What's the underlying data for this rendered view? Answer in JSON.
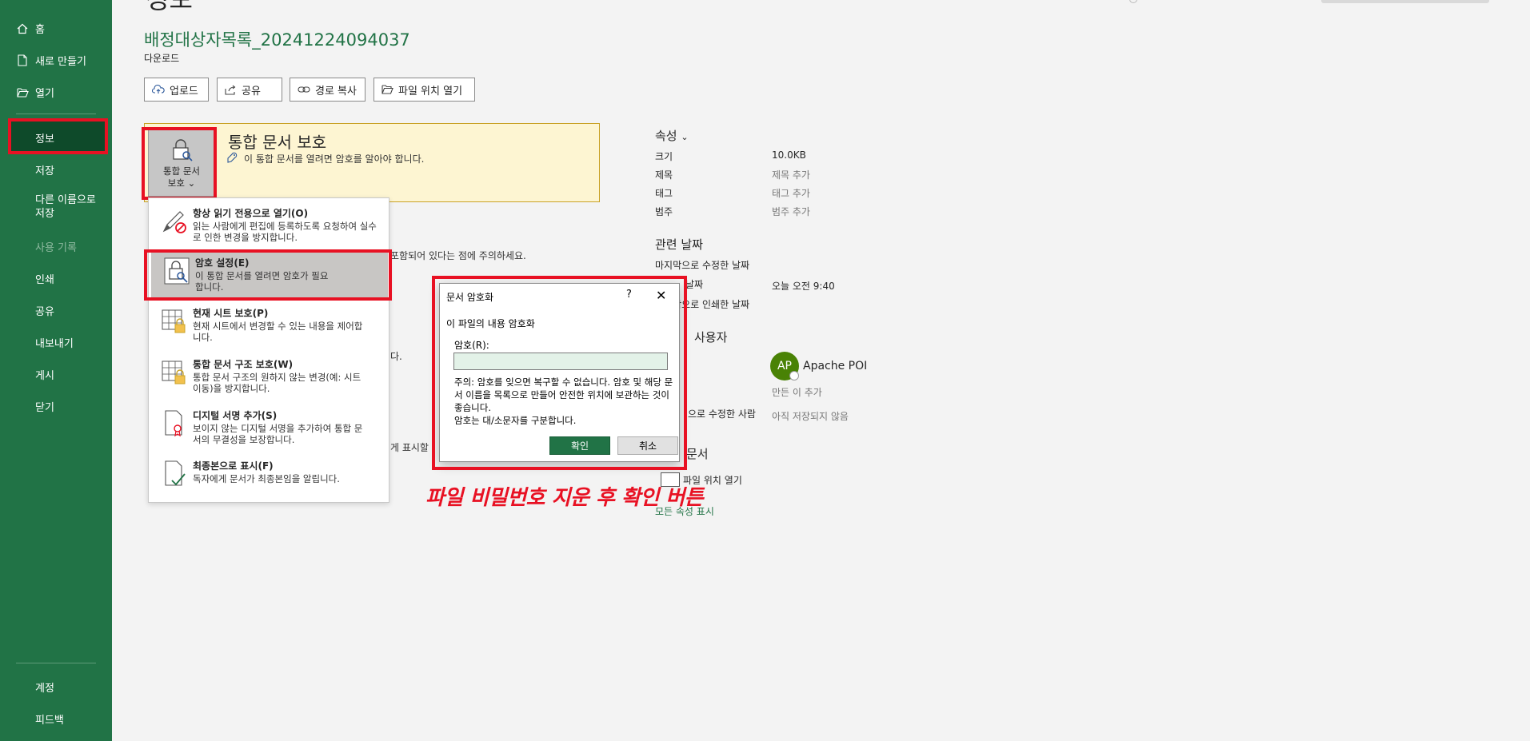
{
  "page": {
    "heading_partial": "정보",
    "title": "배정대상자목록_20241224094037",
    "location": "다운로드"
  },
  "sidebar": {
    "items": [
      {
        "label": "홈",
        "icon": "home-icon"
      },
      {
        "label": "새로 만들기",
        "icon": "new-file-icon"
      },
      {
        "label": "열기",
        "icon": "folder-open-icon"
      },
      {
        "label": "정보"
      },
      {
        "label": "저장"
      },
      {
        "label": "다른 이름으로 저장"
      },
      {
        "label": "사용 기록"
      },
      {
        "label": "인쇄"
      },
      {
        "label": "공유"
      },
      {
        "label": "내보내기"
      },
      {
        "label": "게시"
      },
      {
        "label": "닫기"
      },
      {
        "label": "계정"
      },
      {
        "label": "피드백"
      }
    ],
    "selected": "정보"
  },
  "toolbar": {
    "upload": "업로드",
    "share": "공유",
    "copy_path": "경로 복사",
    "open_location": "파일 위치 열기"
  },
  "protect": {
    "button_line1": "통합 문서",
    "button_line2": "보호",
    "title": "통합 문서 보호",
    "desc": "이 통합 문서를 열려면 암호를 알아야 합니다."
  },
  "menu": {
    "items": [
      {
        "title": "항상 읽기 전용으로 열기(O)",
        "desc": "읽는 사람에게 편집에 등록하도록 요청하여 실수로 인한 변경을 방지합니다.",
        "icon": "pencil-prohibited-icon"
      },
      {
        "title": "암호 설정(E)",
        "desc": "이 통합 문서를 열려면 암호가 필요합니다.",
        "icon": "lock-key-icon"
      },
      {
        "title": "현재 시트 보호(P)",
        "desc": "현재 시트에서 변경할 수 있는 내용을 제어합니다.",
        "icon": "sheet-lock-icon"
      },
      {
        "title": "통합 문서 구조 보호(W)",
        "desc": "통합 문서 구조의 원하지 않는 변경(예: 시트 이동)을 방지합니다.",
        "icon": "workbook-lock-icon"
      },
      {
        "title": "디지털 서명 추가(S)",
        "desc": "보이지 않는 디지털 서명을 추가하여 통합 문서의 무결성을 보장합니다.",
        "icon": "signature-ribbon-icon"
      },
      {
        "title": "최종본으로 표시(F)",
        "desc": "독자에게 문서가 최종본임을 알립니다.",
        "icon": "document-check-icon"
      }
    ]
  },
  "background": {
    "line1": "포함되어 있다는 점에 주의하세요.",
    "line2": "다.",
    "line3": "게 표시할"
  },
  "properties": {
    "heading": "속성",
    "rows": [
      {
        "label": "크기",
        "value": "10.0KB"
      },
      {
        "label": "제목",
        "value": "제목 추가"
      },
      {
        "label": "태그",
        "value": "태그 추가"
      },
      {
        "label": "범주",
        "value": "범주 추가"
      }
    ],
    "dates_heading": "관련 날짜",
    "last_modified_label": "마지막으로 수정한 날짜",
    "created_partial": "날짜",
    "created_value": "오늘 오전 9:40",
    "last_printed_label": "마지막으로 인쇄한 날짜",
    "people_heading_partial": "사용자",
    "author_initials": "AP",
    "author_name": "Apache POI",
    "add_author": "만든 이 추가",
    "last_modified_by_partial": "으로 수정한 사람",
    "last_modified_by_value": "아직 저장되지 않음",
    "docs_heading_partial": "문서",
    "open_location": "파일 위치 열기",
    "show_all": "모든 속성 표시"
  },
  "dialog": {
    "title": "문서 암호화",
    "help": "?",
    "close": "✕",
    "heading": "이 파일의 내용 암호화",
    "password_label": "암호(R):",
    "password_value": "",
    "note": "주의: 암호를 잊으면 복구할 수 없습니다. 암호 및 해당 문서 이름을 목록으로 만들어 안전한 위치에 보관하는 것이 좋습니다.\n암호는 대/소문자를 구분합니다.",
    "ok": "확인",
    "cancel": "취소"
  },
  "annotation": "파일 비밀번호 지운 후 확인 버튼",
  "colors": {
    "sidebar_bg": "#217346",
    "highlight_red": "#e81123",
    "protect_panel_bg": "#fdf5d2",
    "ok_button": "#217346"
  }
}
